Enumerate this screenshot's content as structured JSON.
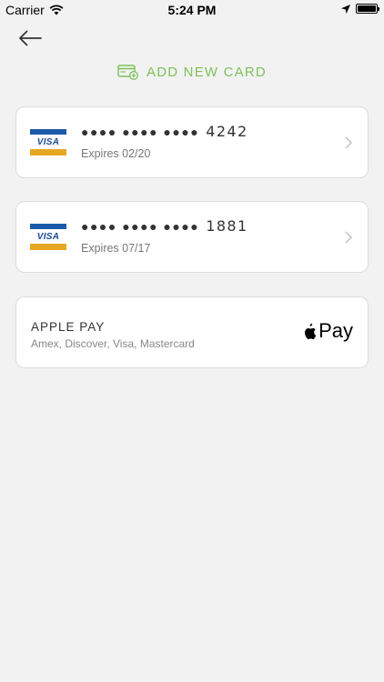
{
  "status_bar": {
    "carrier": "Carrier",
    "time": "5:24 PM"
  },
  "header": {
    "back_icon": "arrow-left-icon"
  },
  "add_card": {
    "label": "ADD NEW CARD",
    "icon": "card-add-icon",
    "color": "#7dc15b"
  },
  "cards": [
    {
      "brand": "VISA",
      "masked": "●●●● ●●●● ●●●●",
      "last4": "4242",
      "expiry": "Expires 02/20"
    },
    {
      "brand": "VISA",
      "masked": "●●●● ●●●● ●●●●",
      "last4": "1881",
      "expiry": "Expires 07/17"
    }
  ],
  "apple_pay": {
    "title": "APPLE PAY",
    "subtitle": "Amex, Discover, Visa, Mastercard",
    "logo_text": "Pay"
  },
  "colors": {
    "background": "#f2f2f2",
    "visa_blue": "#1a5aa8",
    "visa_gold": "#e6a722"
  }
}
